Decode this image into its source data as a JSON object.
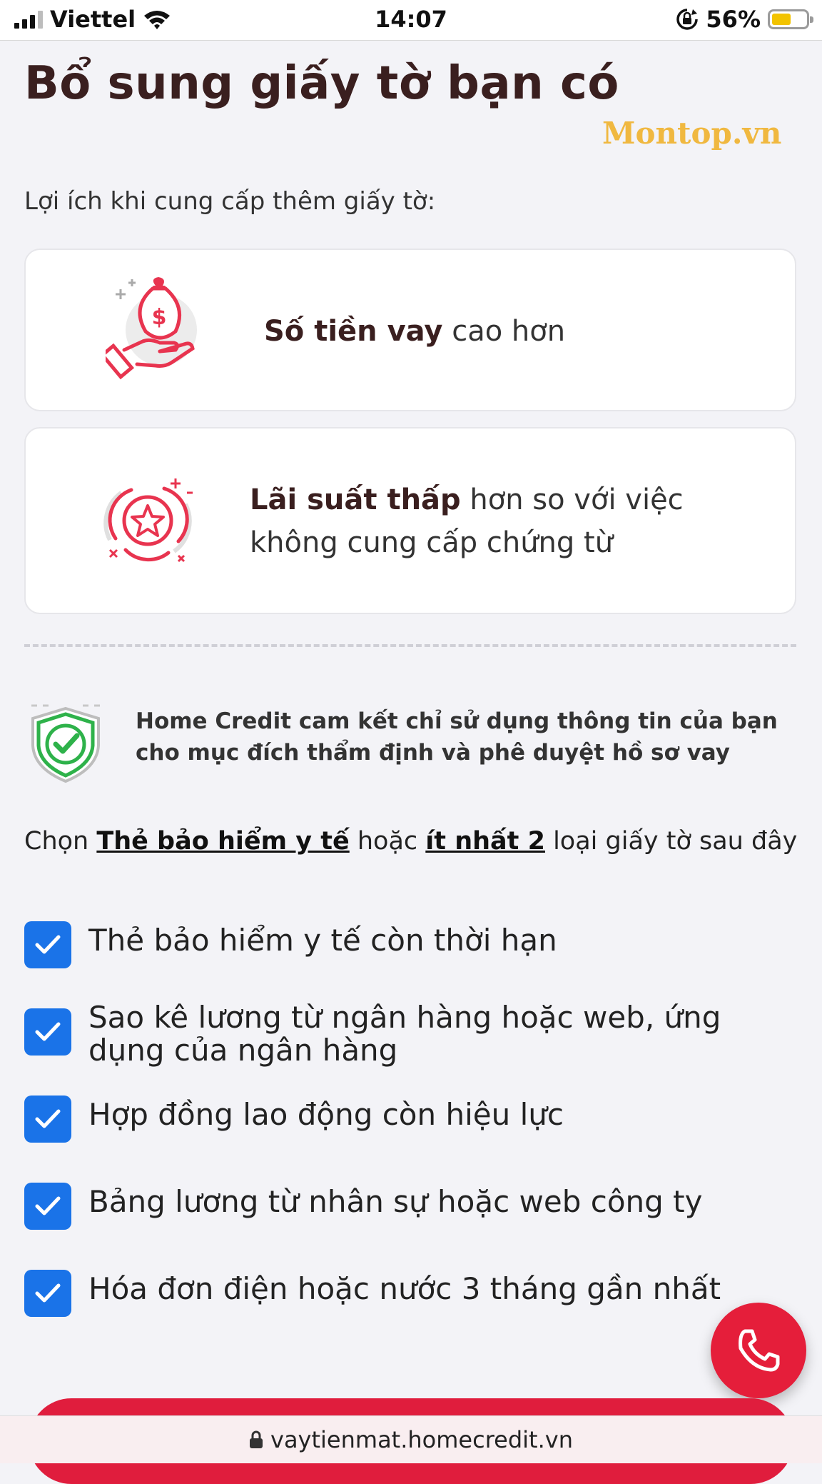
{
  "status_bar": {
    "carrier": "Viettel",
    "time": "14:07",
    "battery": "56%",
    "battery_level": 0.56
  },
  "page": {
    "title": "Bổ sung giấy tờ bạn có",
    "watermark": "Montop.vn",
    "subtitle": "Lợi ích khi cung cấp thêm giấy tờ:"
  },
  "benefits": [
    {
      "icon": "money-bag-hand-icon",
      "bold": "Số tiền vay",
      "rest": " cao hơn"
    },
    {
      "icon": "star-badge-icon",
      "bold": "Lãi suất thấp",
      "rest": " hơn so với việc không cung cấp chứng từ"
    }
  ],
  "commitment": {
    "icon": "shield-check-icon",
    "text": "Home Credit cam kết chỉ sử dụng thông tin của bạn cho mục đích thẩm định và phê duyệt hồ sơ vay"
  },
  "instruction": {
    "prefix": "Chọn ",
    "link1": "Thẻ bảo hiểm y tế",
    "middle": " hoặc ",
    "link2": "ít nhất 2",
    "suffix": " loại giấy tờ sau đây"
  },
  "documents": [
    {
      "label": "Thẻ bảo hiểm y tế còn thời hạn",
      "checked": true
    },
    {
      "label": "Sao kê lương từ ngân hàng hoặc web, ứng dụng của ngân hàng",
      "checked": true
    },
    {
      "label": "Hợp đồng lao động còn hiệu lực",
      "checked": true
    },
    {
      "label": "Bảng lương từ nhân sự hoặc web công ty",
      "checked": true
    },
    {
      "label": "Hóa đơn điện hoặc nước 3 tháng gần nhất",
      "checked": true
    }
  ],
  "call_button": {
    "icon": "phone-icon"
  },
  "url_bar": {
    "icon": "lock-icon",
    "url": "vaytienmat.homecredit.vn"
  },
  "colors": {
    "primary_red": "#e01d3d",
    "checkbox_blue": "#1a73e8",
    "title_brown": "#3a1f1f",
    "watermark_gold": "#f0b840"
  }
}
